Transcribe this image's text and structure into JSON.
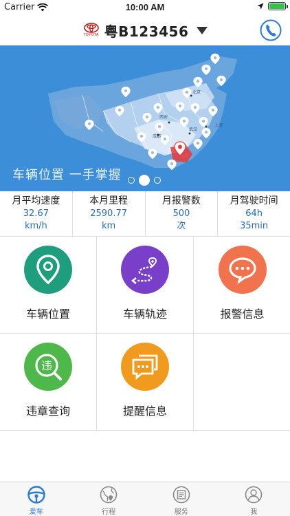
{
  "status_bar": {
    "carrier": "Carrier",
    "time": "10:00 AM",
    "battery_level": 1.0
  },
  "navbar": {
    "brand": "TOYOTA",
    "plate": "粤B123456",
    "icons": {
      "brand": "toyota-logo",
      "dropdown": "caret-down-icon",
      "phone": "phone-icon"
    }
  },
  "hero": {
    "slogan": "车辆位置 一手掌握",
    "map_labels": [
      "北京",
      "西安",
      "成都",
      "武汉",
      "上海",
      "长沙"
    ],
    "slides_total": 3,
    "slide_active": 2
  },
  "stats": [
    {
      "label": "月平均速度",
      "value": "32.67",
      "unit": "km/h"
    },
    {
      "label": "本月里程",
      "value": "2590.77",
      "unit": "km"
    },
    {
      "label": "月报警数",
      "value": "500",
      "unit": "次"
    },
    {
      "label": "月驾驶时间",
      "value": "64h",
      "unit": "35min"
    }
  ],
  "features": [
    {
      "label": "车辆位置",
      "icon": "location-pin-icon",
      "color": "#1f9e7e"
    },
    {
      "label": "车辆轨迹",
      "icon": "route-track-icon",
      "color": "#7a3fc8"
    },
    {
      "label": "报警信息",
      "icon": "alert-chat-icon",
      "color": "#f0734e"
    },
    {
      "label": "违章查询",
      "icon": "violation-search-icon",
      "color": "#4fb84a"
    },
    {
      "label": "提醒信息",
      "icon": "reminder-chat-icon",
      "color": "#f09a1e"
    }
  ],
  "tabs": [
    {
      "label": "爱车",
      "icon": "steering-wheel-icon",
      "active": true
    },
    {
      "label": "行程",
      "icon": "trip-globe-icon",
      "active": false
    },
    {
      "label": "服务",
      "icon": "service-card-icon",
      "active": false
    },
    {
      "label": "我",
      "icon": "user-icon",
      "active": false
    }
  ],
  "colors": {
    "accent": "#2b7bd6",
    "hero_bg": "#3d8ed8",
    "stat_value": "#2b6ab5"
  }
}
